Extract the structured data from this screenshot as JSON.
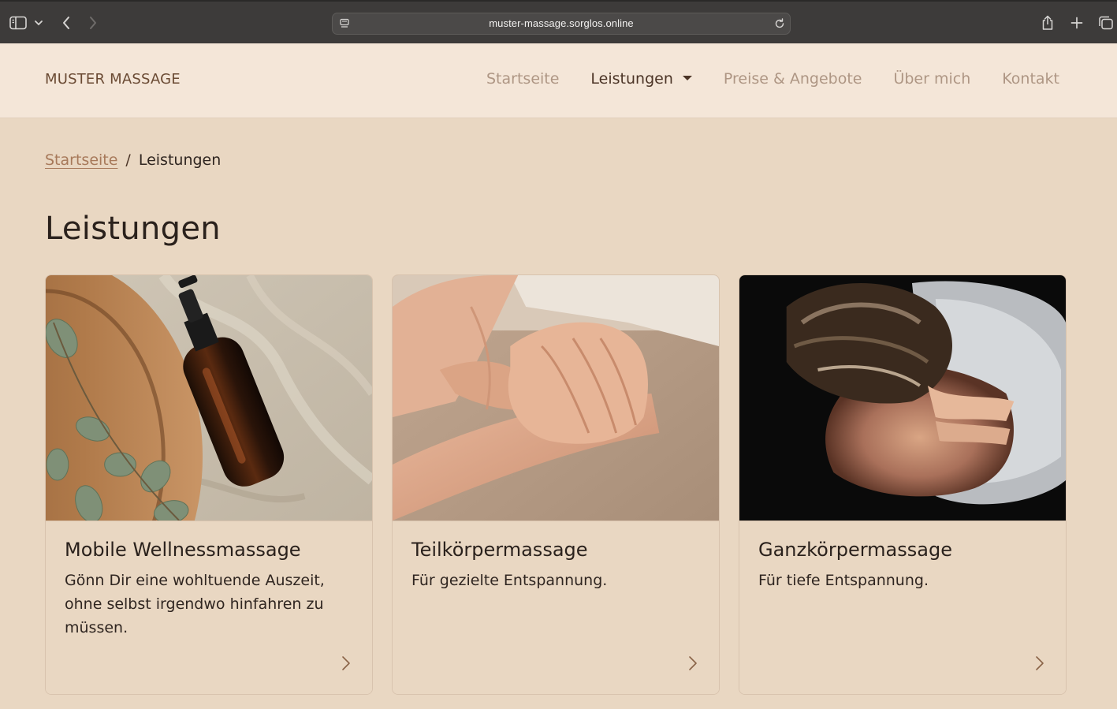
{
  "browser": {
    "url": "muster-massage.sorglos.online",
    "icons": {
      "sidebar": "sidebar-icon",
      "sidebar_menu": "chevron-down-icon",
      "back": "chevron-left-icon",
      "forward": "chevron-right-icon",
      "site": "site-settings-icon",
      "reload": "reload-icon",
      "share": "share-icon",
      "new_tab": "plus-icon",
      "tabs": "tab-overview-icon"
    }
  },
  "header": {
    "brand": "MUSTER MASSAGE",
    "nav": [
      {
        "label": "Startseite"
      },
      {
        "label": "Leistungen",
        "active": true
      },
      {
        "label": "Preise & Angebote"
      },
      {
        "label": "Über mich"
      },
      {
        "label": "Kontakt"
      }
    ]
  },
  "breadcrumb": {
    "home": "Startseite",
    "separator": "/",
    "current": "Leistungen"
  },
  "page": {
    "title": "Leistungen"
  },
  "cards": [
    {
      "title": "Mobile Wellnessmassage",
      "text": "Gönn Dir eine wohltuende Auszeit, ohne selbst irgendwo hinfahren zu müssen.",
      "image": "massage-oil-bottle-photo"
    },
    {
      "title": "Teilkörpermassage",
      "text": "Für gezielte Entspannung.",
      "image": "hands-massage-photo"
    },
    {
      "title": "Ganzkörpermassage",
      "text": "Für tiefe Entspannung.",
      "image": "back-massage-photo"
    }
  ],
  "colors": {
    "background": "#e9d7c2",
    "header_bg": "#f4e6d8",
    "brand": "#6a4a33",
    "nav_inactive": "#ae9684",
    "nav_active": "#4b3426",
    "link": "#a7795a",
    "text": "#2a211c"
  }
}
